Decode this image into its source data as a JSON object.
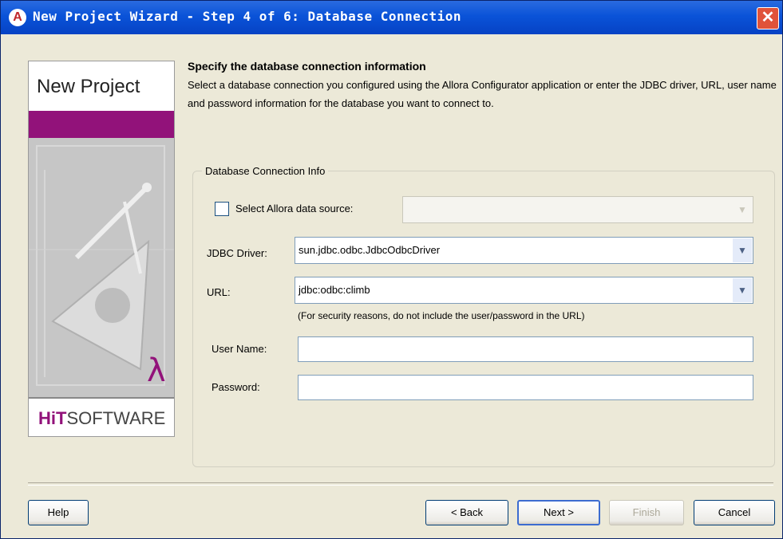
{
  "window": {
    "title": "New Project Wizard - Step 4 of 6: Database Connection",
    "close_symbol": "✕"
  },
  "side_panel": {
    "title": "New Project",
    "brand_bold": "HiT",
    "brand_rest": "SOFTWARE"
  },
  "content": {
    "heading": "Specify the database connection information",
    "description": "Select a database connection you configured using the Allora Configurator application or enter the JDBC driver, URL, user name and password information for the database you want to connect to."
  },
  "group": {
    "label": "Database Connection Info",
    "select_source": {
      "label": "Select Allora data source:",
      "checked": false,
      "value": ""
    },
    "jdbc_driver": {
      "label": "JDBC Driver:",
      "value": "sun.jdbc.odbc.JdbcOdbcDriver"
    },
    "url": {
      "label": "URL:",
      "value": "jdbc:odbc:climb",
      "hint": "(For security reasons, do not include the user/password in the URL)"
    },
    "user_name": {
      "label": "User Name:",
      "value": ""
    },
    "password": {
      "label": "Password:",
      "value": ""
    }
  },
  "buttons": {
    "help": "Help",
    "back": "< Back",
    "next": "Next >",
    "finish": "Finish",
    "cancel": "Cancel"
  },
  "icons": {
    "app": "allora-logo-icon",
    "dropdown": "chevron-down-icon"
  },
  "colors": {
    "titlebar": "#0a53d8",
    "brand": "#92127a",
    "dialog_bg": "#ece9d8"
  }
}
